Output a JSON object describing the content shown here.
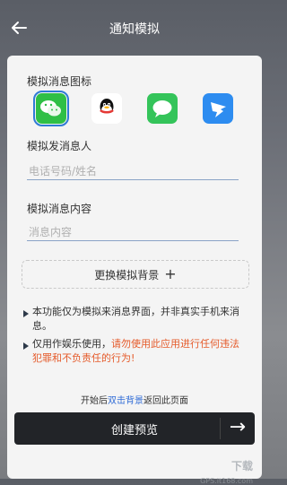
{
  "header": {
    "title": "通知模拟",
    "back_icon": "back-arrow-icon"
  },
  "form": {
    "icon_section_label": "模拟消息图标",
    "icons": [
      {
        "name": "wechat",
        "selected": true,
        "color": "#2fbf46"
      },
      {
        "name": "qq",
        "selected": false,
        "color": "#ffffff"
      },
      {
        "name": "message",
        "selected": false,
        "color": "#34c45a"
      },
      {
        "name": "dingtalk",
        "selected": false,
        "color": "#2d8cf0"
      }
    ],
    "sender_label": "模拟发消息人",
    "sender_placeholder": "电话号码/姓名",
    "content_label": "模拟消息内容",
    "content_placeholder": "消息内容",
    "change_bg_label": "更换模拟背景",
    "plus": "+"
  },
  "notes": {
    "note1": "本功能仅为模拟来消息界面，并非真实手机来消息。",
    "note2_normal": "仅用作娱乐使用，",
    "note2_warning": "请勿使用此应用进行任何违法犯罪和不负责任的行为!"
  },
  "hint": {
    "before": "开始后",
    "highlight": "双击背景",
    "after": "返回此页面"
  },
  "cta": {
    "label": "创建预览",
    "arrow": "→"
  },
  "watermark": {
    "text": "下载",
    "sub": "GPS.it168.com"
  },
  "colors": {
    "accent": "#2f6bd6",
    "warning": "#e55a2a",
    "cta_bg": "#222428"
  }
}
